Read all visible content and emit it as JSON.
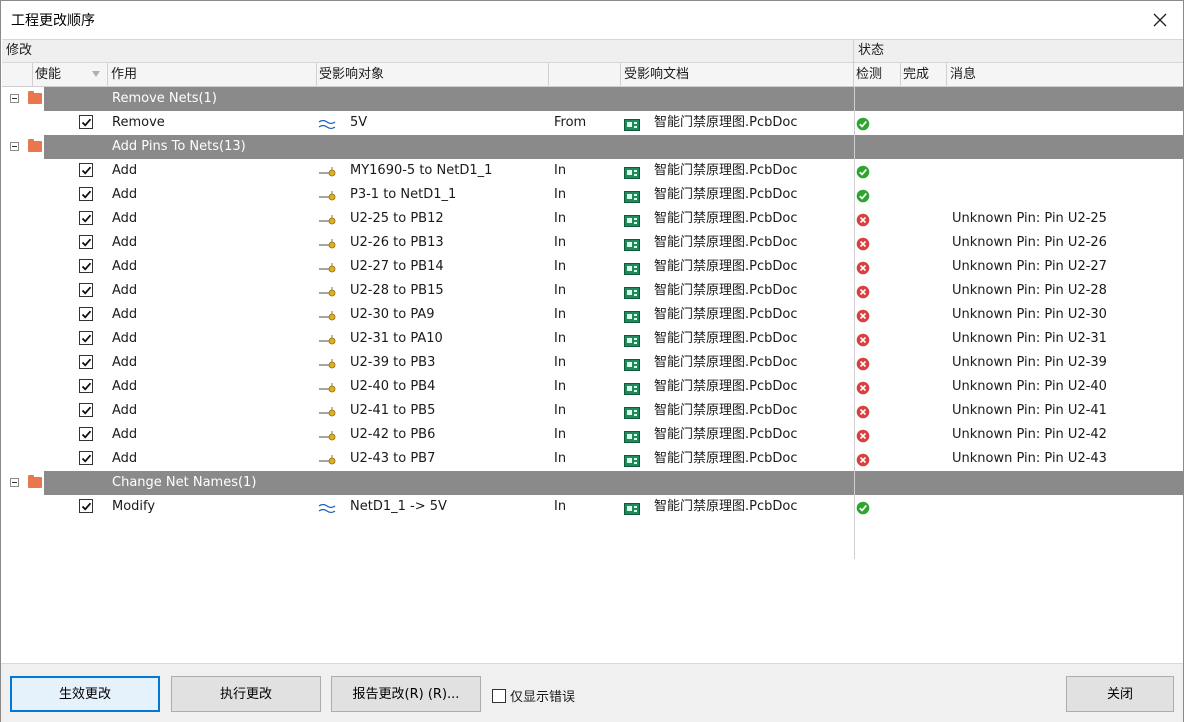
{
  "window": {
    "title": "工程更改顺序"
  },
  "group_headers": {
    "modify": "修改",
    "status": "状态"
  },
  "columns": {
    "enable": "使能",
    "action": "作用",
    "affected_object": "受影响对象",
    "affected_document": "受影响文档",
    "check": "检测",
    "done": "完成",
    "message": "消息"
  },
  "rows": [
    {
      "type": "group",
      "label": "Remove Nets(1)"
    },
    {
      "type": "item",
      "action": "Remove",
      "icon": "net-icon",
      "object": "5V",
      "dir": "From",
      "doc": "智能门禁原理图.PcbDoc",
      "status": "ok",
      "message": ""
    },
    {
      "type": "group",
      "label": "Add Pins To Nets(13)"
    },
    {
      "type": "item",
      "action": "Add",
      "icon": "pin-icon",
      "object": "MY1690-5 to NetD1_1",
      "dir": "In",
      "doc": "智能门禁原理图.PcbDoc",
      "status": "ok",
      "message": ""
    },
    {
      "type": "item",
      "action": "Add",
      "icon": "pin-icon",
      "object": "P3-1 to NetD1_1",
      "dir": "In",
      "doc": "智能门禁原理图.PcbDoc",
      "status": "ok",
      "message": ""
    },
    {
      "type": "item",
      "action": "Add",
      "icon": "pin-icon",
      "object": "U2-25 to PB12",
      "dir": "In",
      "doc": "智能门禁原理图.PcbDoc",
      "status": "error",
      "message": "Unknown Pin: Pin U2-25"
    },
    {
      "type": "item",
      "action": "Add",
      "icon": "pin-icon",
      "object": "U2-26 to PB13",
      "dir": "In",
      "doc": "智能门禁原理图.PcbDoc",
      "status": "error",
      "message": "Unknown Pin: Pin U2-26"
    },
    {
      "type": "item",
      "action": "Add",
      "icon": "pin-icon",
      "object": "U2-27 to PB14",
      "dir": "In",
      "doc": "智能门禁原理图.PcbDoc",
      "status": "error",
      "message": "Unknown Pin: Pin U2-27"
    },
    {
      "type": "item",
      "action": "Add",
      "icon": "pin-icon",
      "object": "U2-28 to PB15",
      "dir": "In",
      "doc": "智能门禁原理图.PcbDoc",
      "status": "error",
      "message": "Unknown Pin: Pin U2-28"
    },
    {
      "type": "item",
      "action": "Add",
      "icon": "pin-icon",
      "object": "U2-30 to PA9",
      "dir": "In",
      "doc": "智能门禁原理图.PcbDoc",
      "status": "error",
      "message": "Unknown Pin: Pin U2-30"
    },
    {
      "type": "item",
      "action": "Add",
      "icon": "pin-icon",
      "object": "U2-31 to PA10",
      "dir": "In",
      "doc": "智能门禁原理图.PcbDoc",
      "status": "error",
      "message": "Unknown Pin: Pin U2-31"
    },
    {
      "type": "item",
      "action": "Add",
      "icon": "pin-icon",
      "object": "U2-39 to PB3",
      "dir": "In",
      "doc": "智能门禁原理图.PcbDoc",
      "status": "error",
      "message": "Unknown Pin: Pin U2-39"
    },
    {
      "type": "item",
      "action": "Add",
      "icon": "pin-icon",
      "object": "U2-40 to PB4",
      "dir": "In",
      "doc": "智能门禁原理图.PcbDoc",
      "status": "error",
      "message": "Unknown Pin: Pin U2-40"
    },
    {
      "type": "item",
      "action": "Add",
      "icon": "pin-icon",
      "object": "U2-41 to PB5",
      "dir": "In",
      "doc": "智能门禁原理图.PcbDoc",
      "status": "error",
      "message": "Unknown Pin: Pin U2-41"
    },
    {
      "type": "item",
      "action": "Add",
      "icon": "pin-icon",
      "object": "U2-42 to PB6",
      "dir": "In",
      "doc": "智能门禁原理图.PcbDoc",
      "status": "error",
      "message": "Unknown Pin: Pin U2-42"
    },
    {
      "type": "item",
      "action": "Add",
      "icon": "pin-icon",
      "object": "U2-43 to PB7",
      "dir": "In",
      "doc": "智能门禁原理图.PcbDoc",
      "status": "error",
      "message": "Unknown Pin: Pin U2-43"
    },
    {
      "type": "group",
      "label": "Change Net Names(1)"
    },
    {
      "type": "item",
      "action": "Modify",
      "icon": "net-icon",
      "object": "NetD1_1 -> 5V",
      "dir": "In",
      "doc": "智能门禁原理图.PcbDoc",
      "status": "ok",
      "message": ""
    }
  ],
  "footer": {
    "validate_label": "生效更改",
    "execute_label": "执行更改",
    "report_label": "报告更改(R) (R)...",
    "only_errors_label": "仅显示错误",
    "close_label": "关闭"
  },
  "colors": {
    "group_row_bg": "#8a8a8a",
    "ok": "#2fa52f",
    "error": "#d94040",
    "folder": "#e8774e",
    "primary_border": "#0078d7"
  }
}
